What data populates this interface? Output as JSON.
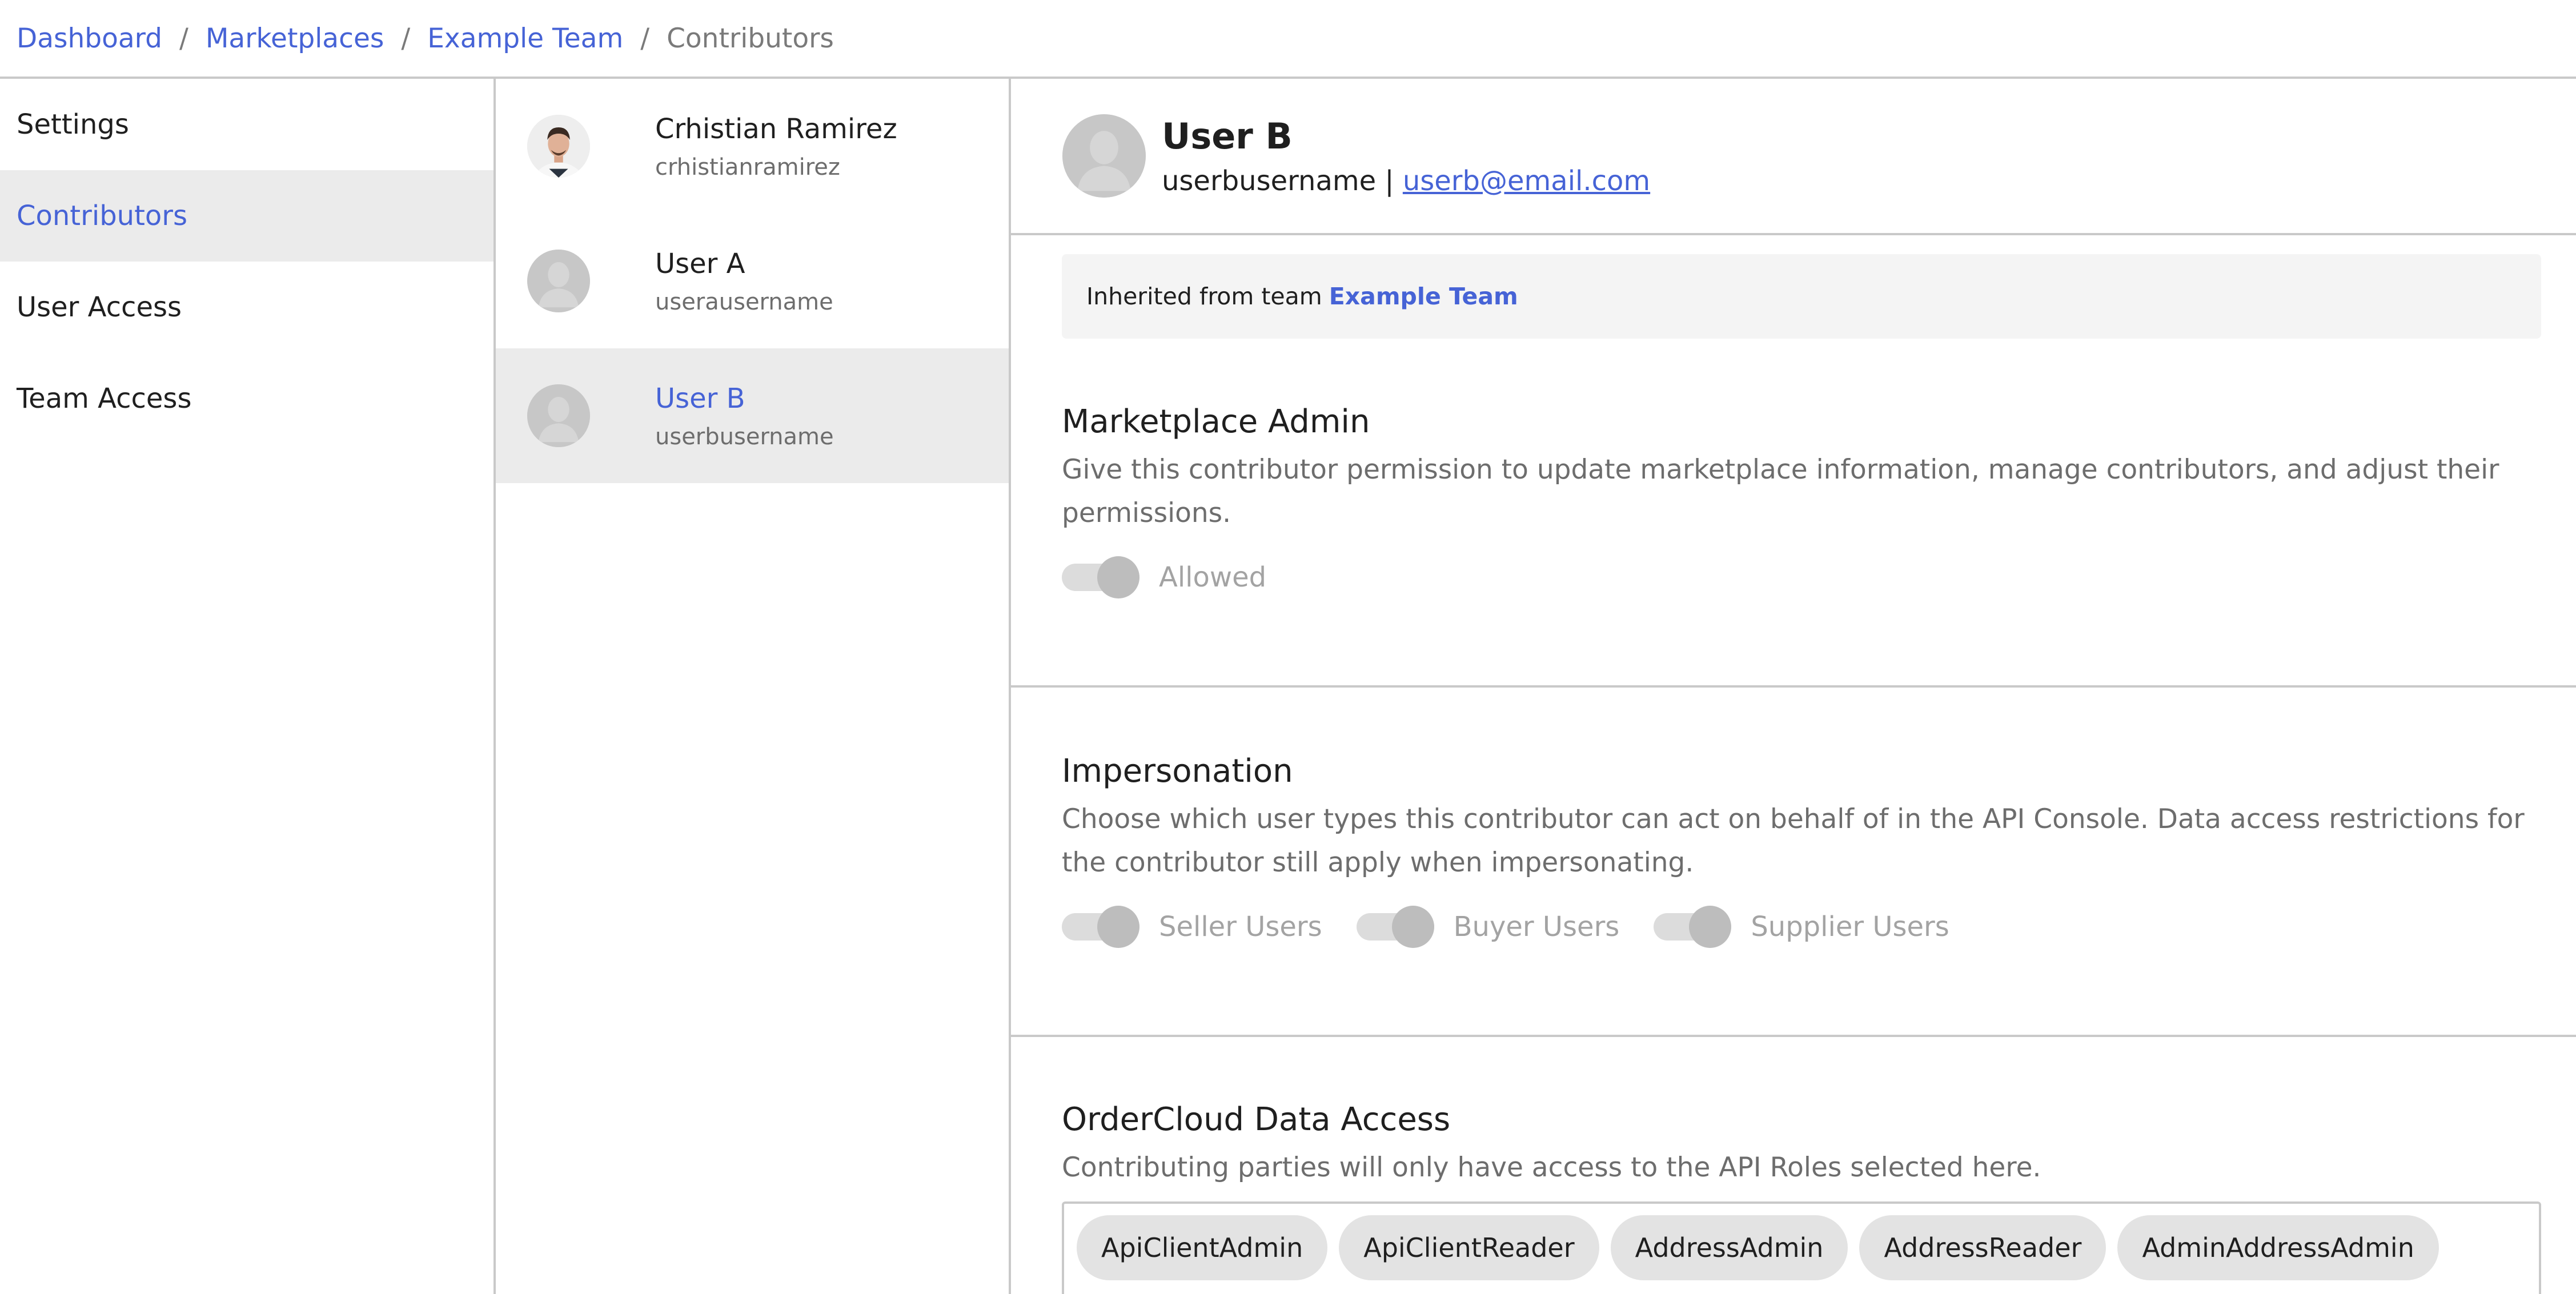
{
  "breadcrumb": {
    "items": [
      "Dashboard",
      "Marketplaces",
      "Example Team"
    ],
    "current": "Contributors",
    "separator": "/"
  },
  "nav": {
    "items": [
      {
        "label": "Settings"
      },
      {
        "label": "Contributors"
      },
      {
        "label": "User Access"
      },
      {
        "label": "Team Access"
      }
    ],
    "active": "Contributors"
  },
  "contributors": [
    {
      "name": "Crhistian Ramirez",
      "username": "crhistianramirez",
      "avatar": "photo-avatar"
    },
    {
      "name": "User A",
      "username": "userausername",
      "avatar": "default-avatar-icon"
    },
    {
      "name": "User B",
      "username": "userbusername",
      "avatar": "default-avatar-icon"
    }
  ],
  "selected": {
    "name": "User B",
    "username": "userbusername",
    "separator": "|",
    "email": "userb@email.com"
  },
  "inherited": {
    "prefix": "Inherited from team",
    "team": "Example Team"
  },
  "sections": {
    "marketplace_admin": {
      "title": "Marketplace Admin",
      "description": "Give this contributor permission to update marketplace information, manage contributors, and adjust their permissions.",
      "toggles": [
        {
          "label": "Allowed"
        }
      ]
    },
    "impersonation": {
      "title": "Impersonation",
      "description": "Choose which user types this contributor can act on behalf of in the API Console. Data access restrictions for the contributor still apply when impersonating.",
      "toggles": [
        {
          "label": "Seller Users"
        },
        {
          "label": "Buyer Users"
        },
        {
          "label": "Supplier Users"
        }
      ]
    },
    "data_access": {
      "title": "OrderCloud Data Access",
      "description": "Contributing parties will only have access to the API Roles selected here.",
      "roles": [
        "ApiClientAdmin",
        "ApiClientReader",
        "AddressAdmin",
        "AddressReader",
        "AdminAddressAdmin"
      ]
    }
  },
  "colors": {
    "accent": "#4663d6",
    "active_bg": "#ebebeb",
    "border": "#c9c9c9",
    "muted_text": "#6d6d6d",
    "toggle_disabled": "#bdbdbd"
  }
}
